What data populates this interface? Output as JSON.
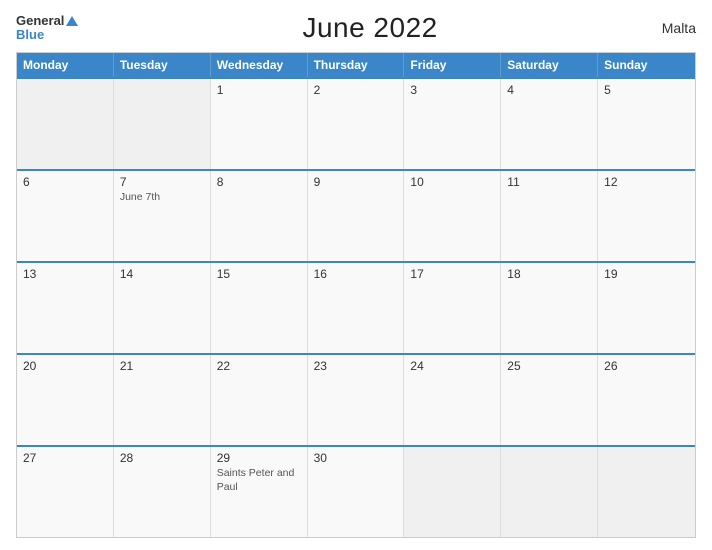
{
  "header": {
    "logo_general": "General",
    "logo_blue": "Blue",
    "title": "June 2022",
    "country": "Malta"
  },
  "days_of_week": [
    "Monday",
    "Tuesday",
    "Wednesday",
    "Thursday",
    "Friday",
    "Saturday",
    "Sunday"
  ],
  "weeks": [
    [
      {
        "num": "",
        "event": ""
      },
      {
        "num": "",
        "event": ""
      },
      {
        "num": "1",
        "event": ""
      },
      {
        "num": "2",
        "event": ""
      },
      {
        "num": "3",
        "event": ""
      },
      {
        "num": "4",
        "event": ""
      },
      {
        "num": "5",
        "event": ""
      }
    ],
    [
      {
        "num": "6",
        "event": ""
      },
      {
        "num": "7",
        "event": "June 7th"
      },
      {
        "num": "8",
        "event": ""
      },
      {
        "num": "9",
        "event": ""
      },
      {
        "num": "10",
        "event": ""
      },
      {
        "num": "11",
        "event": ""
      },
      {
        "num": "12",
        "event": ""
      }
    ],
    [
      {
        "num": "13",
        "event": ""
      },
      {
        "num": "14",
        "event": ""
      },
      {
        "num": "15",
        "event": ""
      },
      {
        "num": "16",
        "event": ""
      },
      {
        "num": "17",
        "event": ""
      },
      {
        "num": "18",
        "event": ""
      },
      {
        "num": "19",
        "event": ""
      }
    ],
    [
      {
        "num": "20",
        "event": ""
      },
      {
        "num": "21",
        "event": ""
      },
      {
        "num": "22",
        "event": ""
      },
      {
        "num": "23",
        "event": ""
      },
      {
        "num": "24",
        "event": ""
      },
      {
        "num": "25",
        "event": ""
      },
      {
        "num": "26",
        "event": ""
      }
    ],
    [
      {
        "num": "27",
        "event": ""
      },
      {
        "num": "28",
        "event": ""
      },
      {
        "num": "29",
        "event": "Saints Peter and Paul"
      },
      {
        "num": "30",
        "event": ""
      },
      {
        "num": "",
        "event": ""
      },
      {
        "num": "",
        "event": ""
      },
      {
        "num": "",
        "event": ""
      }
    ]
  ]
}
